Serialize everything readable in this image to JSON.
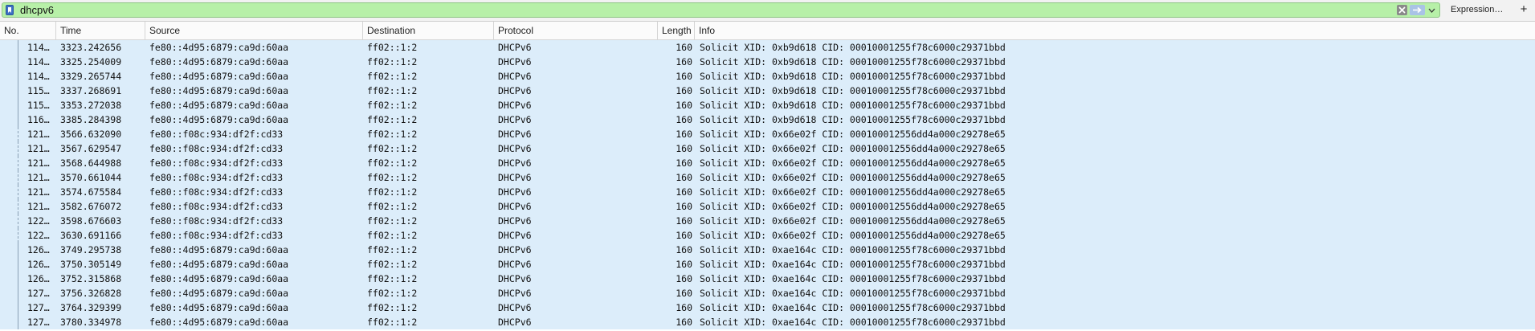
{
  "filter": {
    "value": "dhcpv6",
    "expression_label": "Expression…",
    "add_label": "+"
  },
  "columns": [
    "No.",
    "Time",
    "Source",
    "Destination",
    "Protocol",
    "Length",
    "Info"
  ],
  "rows": [
    {
      "no": "114…",
      "time": "3323.242656",
      "src": "fe80::4d95:6879:ca9d:60aa",
      "dst": "ff02::1:2",
      "proto": "DHCPv6",
      "len": "160",
      "info": "Solicit XID: 0xb9d618 CID: 00010001255f78c6000c29371bbd",
      "line": "solid"
    },
    {
      "no": "114…",
      "time": "3325.254009",
      "src": "fe80::4d95:6879:ca9d:60aa",
      "dst": "ff02::1:2",
      "proto": "DHCPv6",
      "len": "160",
      "info": "Solicit XID: 0xb9d618 CID: 00010001255f78c6000c29371bbd",
      "line": "solid"
    },
    {
      "no": "114…",
      "time": "3329.265744",
      "src": "fe80::4d95:6879:ca9d:60aa",
      "dst": "ff02::1:2",
      "proto": "DHCPv6",
      "len": "160",
      "info": "Solicit XID: 0xb9d618 CID: 00010001255f78c6000c29371bbd",
      "line": "solid"
    },
    {
      "no": "115…",
      "time": "3337.268691",
      "src": "fe80::4d95:6879:ca9d:60aa",
      "dst": "ff02::1:2",
      "proto": "DHCPv6",
      "len": "160",
      "info": "Solicit XID: 0xb9d618 CID: 00010001255f78c6000c29371bbd",
      "line": "solid"
    },
    {
      "no": "115…",
      "time": "3353.272038",
      "src": "fe80::4d95:6879:ca9d:60aa",
      "dst": "ff02::1:2",
      "proto": "DHCPv6",
      "len": "160",
      "info": "Solicit XID: 0xb9d618 CID: 00010001255f78c6000c29371bbd",
      "line": "solid"
    },
    {
      "no": "116…",
      "time": "3385.284398",
      "src": "fe80::4d95:6879:ca9d:60aa",
      "dst": "ff02::1:2",
      "proto": "DHCPv6",
      "len": "160",
      "info": "Solicit XID: 0xb9d618 CID: 00010001255f78c6000c29371bbd",
      "line": "solid"
    },
    {
      "no": "121…",
      "time": "3566.632090",
      "src": "fe80::f08c:934:df2f:cd33",
      "dst": "ff02::1:2",
      "proto": "DHCPv6",
      "len": "160",
      "info": "Solicit XID: 0x66e02f CID: 000100012556dd4a000c29278e65",
      "line": "dashed"
    },
    {
      "no": "121…",
      "time": "3567.629547",
      "src": "fe80::f08c:934:df2f:cd33",
      "dst": "ff02::1:2",
      "proto": "DHCPv6",
      "len": "160",
      "info": "Solicit XID: 0x66e02f CID: 000100012556dd4a000c29278e65",
      "line": "dashed"
    },
    {
      "no": "121…",
      "time": "3568.644988",
      "src": "fe80::f08c:934:df2f:cd33",
      "dst": "ff02::1:2",
      "proto": "DHCPv6",
      "len": "160",
      "info": "Solicit XID: 0x66e02f CID: 000100012556dd4a000c29278e65",
      "line": "dashed"
    },
    {
      "no": "121…",
      "time": "3570.661044",
      "src": "fe80::f08c:934:df2f:cd33",
      "dst": "ff02::1:2",
      "proto": "DHCPv6",
      "len": "160",
      "info": "Solicit XID: 0x66e02f CID: 000100012556dd4a000c29278e65",
      "line": "dashed"
    },
    {
      "no": "121…",
      "time": "3574.675584",
      "src": "fe80::f08c:934:df2f:cd33",
      "dst": "ff02::1:2",
      "proto": "DHCPv6",
      "len": "160",
      "info": "Solicit XID: 0x66e02f CID: 000100012556dd4a000c29278e65",
      "line": "dashed"
    },
    {
      "no": "121…",
      "time": "3582.676072",
      "src": "fe80::f08c:934:df2f:cd33",
      "dst": "ff02::1:2",
      "proto": "DHCPv6",
      "len": "160",
      "info": "Solicit XID: 0x66e02f CID: 000100012556dd4a000c29278e65",
      "line": "dashed"
    },
    {
      "no": "122…",
      "time": "3598.676603",
      "src": "fe80::f08c:934:df2f:cd33",
      "dst": "ff02::1:2",
      "proto": "DHCPv6",
      "len": "160",
      "info": "Solicit XID: 0x66e02f CID: 000100012556dd4a000c29278e65",
      "line": "dashed"
    },
    {
      "no": "122…",
      "time": "3630.691166",
      "src": "fe80::f08c:934:df2f:cd33",
      "dst": "ff02::1:2",
      "proto": "DHCPv6",
      "len": "160",
      "info": "Solicit XID: 0x66e02f CID: 000100012556dd4a000c29278e65",
      "line": "dashed"
    },
    {
      "no": "126…",
      "time": "3749.295738",
      "src": "fe80::4d95:6879:ca9d:60aa",
      "dst": "ff02::1:2",
      "proto": "DHCPv6",
      "len": "160",
      "info": "Solicit XID: 0xae164c CID: 00010001255f78c6000c29371bbd",
      "line": "solid"
    },
    {
      "no": "126…",
      "time": "3750.305149",
      "src": "fe80::4d95:6879:ca9d:60aa",
      "dst": "ff02::1:2",
      "proto": "DHCPv6",
      "len": "160",
      "info": "Solicit XID: 0xae164c CID: 00010001255f78c6000c29371bbd",
      "line": "solid"
    },
    {
      "no": "126…",
      "time": "3752.315868",
      "src": "fe80::4d95:6879:ca9d:60aa",
      "dst": "ff02::1:2",
      "proto": "DHCPv6",
      "len": "160",
      "info": "Solicit XID: 0xae164c CID: 00010001255f78c6000c29371bbd",
      "line": "solid"
    },
    {
      "no": "127…",
      "time": "3756.326828",
      "src": "fe80::4d95:6879:ca9d:60aa",
      "dst": "ff02::1:2",
      "proto": "DHCPv6",
      "len": "160",
      "info": "Solicit XID: 0xae164c CID: 00010001255f78c6000c29371bbd",
      "line": "solid"
    },
    {
      "no": "127…",
      "time": "3764.329399",
      "src": "fe80::4d95:6879:ca9d:60aa",
      "dst": "ff02::1:2",
      "proto": "DHCPv6",
      "len": "160",
      "info": "Solicit XID: 0xae164c CID: 00010001255f78c6000c29371bbd",
      "line": "solid"
    },
    {
      "no": "127…",
      "time": "3780.334978",
      "src": "fe80::4d95:6879:ca9d:60aa",
      "dst": "ff02::1:2",
      "proto": "DHCPv6",
      "len": "160",
      "info": "Solicit XID: 0xae164c CID: 00010001255f78c6000c29371bbd",
      "line": "solid"
    }
  ]
}
